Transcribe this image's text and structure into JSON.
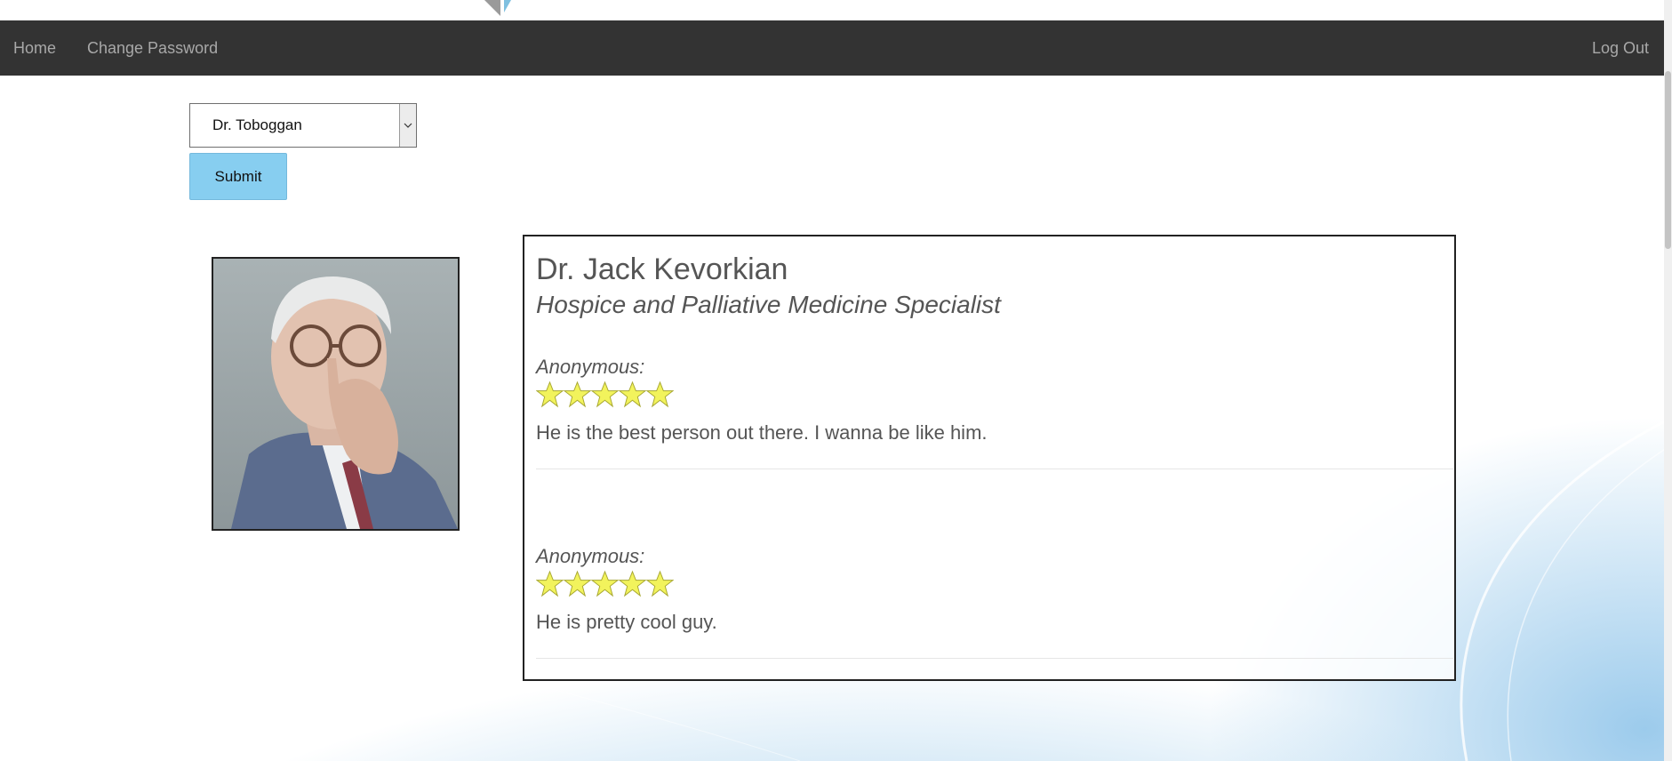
{
  "nav": {
    "home_label": "Home",
    "change_password_label": "Change Password",
    "logout_label": "Log Out"
  },
  "doctor_select": {
    "selected": "Dr. Toboggan",
    "submit_label": "Submit"
  },
  "profile": {
    "name": "Dr. Jack Kevorkian",
    "specialty": "Hospice and Palliative Medicine Specialist",
    "reviews": [
      {
        "author": "Anonymous:",
        "stars": 5,
        "text": "He is the best person out there. I wanna be like him."
      },
      {
        "author": "Anonymous:",
        "stars": 5,
        "text": "He is pretty cool guy."
      }
    ]
  },
  "colors": {
    "navbar": "#333333",
    "nav_text": "#a8a8a8",
    "submit_button": "#87cef0",
    "star_fill": "#f2f35c"
  },
  "icons": {
    "star": "star-icon",
    "select_arrow": "chevron-down-icon",
    "logo": "logo-icon"
  }
}
